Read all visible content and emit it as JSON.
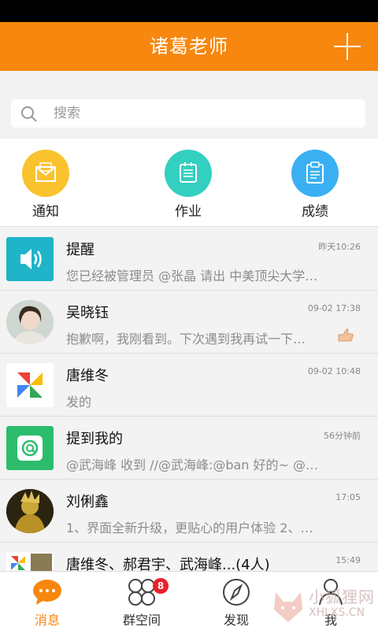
{
  "app_title": "诸葛老师",
  "search": {
    "placeholder": "搜索"
  },
  "shortcuts": [
    {
      "label": "通知",
      "icon": "envelope-icon",
      "color": "#f9c22e"
    },
    {
      "label": "作业",
      "icon": "notepad-icon",
      "color": "#33cfc0"
    },
    {
      "label": "成绩",
      "icon": "clipboard-icon",
      "color": "#3ab0f2"
    }
  ],
  "conversations": [
    {
      "name": "提醒",
      "time": "昨天10:26",
      "preview": "您已经被管理员 @张晶 请出 中美顶尖大学…",
      "avatar": "speaker-icon"
    },
    {
      "name": "吴晓钰",
      "time": "09-02 17:38",
      "preview": "抱歉啊，我刚看到。下次遇到我再试一下…",
      "avatar": "user-photo"
    },
    {
      "name": "唐维冬",
      "time": "09-02 10:48",
      "preview": "发的",
      "avatar": "pinwheel-icon"
    },
    {
      "name": "提到我的",
      "time": "56分钟前",
      "preview": "@武海峰 收到 //@武海峰:@ban 好的~ @…",
      "avatar": "at-icon"
    },
    {
      "name": "刘俐鑫",
      "time": "17:05",
      "preview": "1、界面全新升级，更贴心的用户体验 2、…",
      "avatar": "user-photo"
    },
    {
      "name": "唐维冬、郝君宇、武海峰...(4人)",
      "time": "15:49",
      "preview": "",
      "avatar": "group-avatar"
    }
  ],
  "tabs": [
    {
      "label": "消息",
      "icon": "chat-bubble-icon",
      "active": true
    },
    {
      "label": "群空间",
      "icon": "group-space-icon",
      "badge": "8"
    },
    {
      "label": "发现",
      "icon": "compass-icon"
    },
    {
      "label": "我",
      "icon": "person-icon"
    }
  ],
  "watermark": {
    "line1": "小狐狸网",
    "line2": "XHLXS.CN"
  },
  "colors": {
    "accent": "#f7870e",
    "badge": "#e8212a"
  }
}
